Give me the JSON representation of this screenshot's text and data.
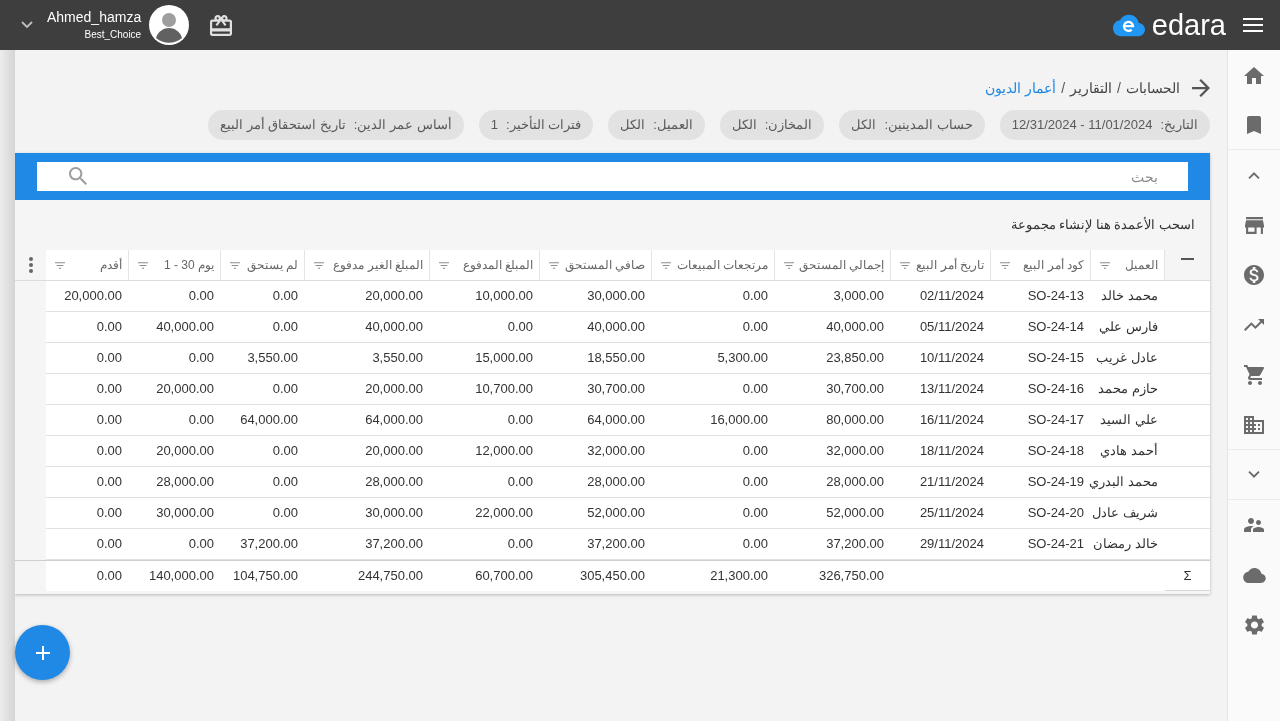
{
  "top_bar": {
    "user_name": "Ahmed_hamza",
    "company": "Best_Choice",
    "logo_text": "edara"
  },
  "breadcrumb": [
    {
      "kind": "link",
      "label": "الحسابات"
    },
    {
      "kind": "separator",
      "label": "/"
    },
    {
      "kind": "link",
      "label": "التقارير"
    },
    {
      "kind": "separator",
      "label": "/"
    },
    {
      "kind": "current",
      "label": "أعمار الديون"
    }
  ],
  "filters": [
    {
      "label": "التاريخ:",
      "value": "12/31/2024 - 11/01/2024"
    },
    {
      "label": "حساب المدينين:",
      "value": "الكل"
    },
    {
      "label": "المخازن:",
      "value": "الكل"
    },
    {
      "label": "العميل:",
      "value": "الكل"
    },
    {
      "label": "فترات التأخير:",
      "value": "1"
    },
    {
      "label": "أساس عمر الدين:",
      "value": "تاريخ استحقاق أمر البيع"
    }
  ],
  "search": {
    "placeholder": "بحث"
  },
  "group_panel": {
    "hint": "اسحب الأعمدة هنا لإنشاء مجموعة"
  },
  "table": {
    "columns": [
      "أقدم",
      "1 - 30 يوم",
      "لم يستحق",
      "المبلغ الغير مدفوع",
      "المبلغ المدفوع",
      "صافي المستحق",
      "مرتجعات المبيعات",
      "إجمالي المستحق",
      "تاريخ أمر البيع",
      "كود أمر البيع",
      "العميل"
    ],
    "rows": [
      {
        "cells": [
          "20,000.00",
          "0.00",
          "0.00",
          "20,000.00",
          "10,000.00",
          "30,000.00",
          "0.00",
          "3,000.00",
          "02/11/2024",
          "SO-24-13",
          "محمد خالد"
        ]
      },
      {
        "cells": [
          "0.00",
          "40,000.00",
          "0.00",
          "40,000.00",
          "0.00",
          "40,000.00",
          "0.00",
          "40,000.00",
          "05/11/2024",
          "SO-24-14",
          "فارس علي"
        ]
      },
      {
        "cells": [
          "0.00",
          "0.00",
          "3,550.00",
          "3,550.00",
          "15,000.00",
          "18,550.00",
          "5,300.00",
          "23,850.00",
          "10/11/2024",
          "SO-24-15",
          "عادل غريب"
        ]
      },
      {
        "cells": [
          "0.00",
          "20,000.00",
          "0.00",
          "20,000.00",
          "10,700.00",
          "30,700.00",
          "0.00",
          "30,700.00",
          "13/11/2024",
          "SO-24-16",
          "حازم محمد"
        ]
      },
      {
        "cells": [
          "0.00",
          "0.00",
          "64,000.00",
          "64,000.00",
          "0.00",
          "64,000.00",
          "16,000.00",
          "80,000.00",
          "16/11/2024",
          "SO-24-17",
          "علي السيد"
        ]
      },
      {
        "cells": [
          "0.00",
          "20,000.00",
          "0.00",
          "20,000.00",
          "12,000.00",
          "32,000.00",
          "0.00",
          "32,000.00",
          "18/11/2024",
          "SO-24-18",
          "أحمد هادي"
        ]
      },
      {
        "cells": [
          "0.00",
          "28,000.00",
          "0.00",
          "28,000.00",
          "0.00",
          "28,000.00",
          "0.00",
          "28,000.00",
          "21/11/2024",
          "SO-24-19",
          "محمد البدري"
        ]
      },
      {
        "cells": [
          "0.00",
          "30,000.00",
          "0.00",
          "30,000.00",
          "22,000.00",
          "52,000.00",
          "0.00",
          "52,000.00",
          "25/11/2024",
          "SO-24-20",
          "شريف عادل"
        ]
      },
      {
        "cells": [
          "0.00",
          "0.00",
          "37,200.00",
          "37,200.00",
          "0.00",
          "37,200.00",
          "0.00",
          "37,200.00",
          "29/11/2024",
          "SO-24-21",
          "خالد رمضان"
        ]
      }
    ],
    "totals": {
      "symbol": "Σ",
      "cells": [
        "0.00",
        "140,000.00",
        "104,750.00",
        "244,750.00",
        "60,700.00",
        "305,450.00",
        "21,300.00",
        "326,750.00",
        null,
        null,
        null
      ]
    }
  }
}
